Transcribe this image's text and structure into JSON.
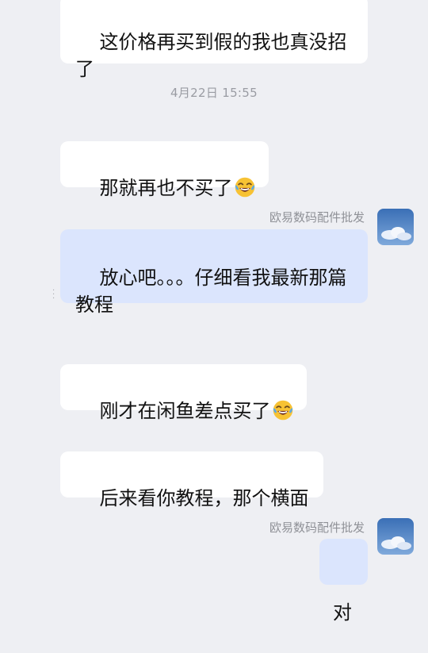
{
  "messages": [
    {
      "direction": "in",
      "text": "这价格再买到假的我也真没招\n了"
    },
    {
      "direction": "in",
      "text": "那就再也不买了",
      "emoji": "tears-of-joy-emoji"
    },
    {
      "direction": "out",
      "sender": "欧易数码配件批发",
      "text": "放心吧。。。仔细看我最新那篇\n教程"
    },
    {
      "direction": "in",
      "text": "刚才在闲鱼差点买了",
      "emoji": "tears-of-joy-emoji"
    },
    {
      "direction": "in",
      "text": "后来看你教程，那个横面"
    },
    {
      "direction": "out",
      "sender": "欧易数码配件批发",
      "text": "对"
    }
  ],
  "timestamp": "4月22日 15:55",
  "colors": {
    "background": "#eeeff3",
    "incoming_bubble": "#ffffff",
    "outgoing_bubble": "#dbe5fd",
    "meta_text": "#9a9ca3"
  }
}
